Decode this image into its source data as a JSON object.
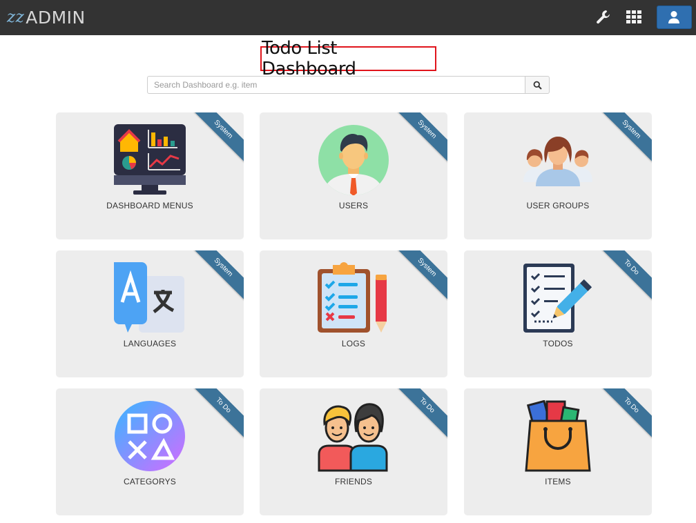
{
  "app": {
    "logo_mark": "zz",
    "logo_text": "ADMIN"
  },
  "header": {
    "title": "Todo List Dashboard"
  },
  "search": {
    "placeholder": "Search Dashboard e.g. item",
    "value": ""
  },
  "cards": [
    {
      "label": "DASHBOARD MENUS",
      "ribbon": "System",
      "icon": "dashboard-monitor-icon"
    },
    {
      "label": "USERS",
      "ribbon": "System",
      "icon": "user-avatar-icon"
    },
    {
      "label": "USER GROUPS",
      "ribbon": "System",
      "icon": "user-group-icon"
    },
    {
      "label": "LANGUAGES",
      "ribbon": "System",
      "icon": "translate-icon"
    },
    {
      "label": "LOGS",
      "ribbon": "System",
      "icon": "clipboard-checklist-icon"
    },
    {
      "label": "TODOS",
      "ribbon": "To Do",
      "icon": "todo-list-pen-icon"
    },
    {
      "label": "CATEGORYS",
      "ribbon": "To Do",
      "icon": "shapes-icon"
    },
    {
      "label": "FRIENDS",
      "ribbon": "To Do",
      "icon": "friends-icon"
    },
    {
      "label": "ITEMS",
      "ribbon": "To Do",
      "icon": "shopping-bag-icon"
    }
  ],
  "colors": {
    "topbar": "#333333",
    "accent": "#2f6fb0",
    "ribbon": "#3c7399",
    "card_bg": "#ededed",
    "title_border": "#e0131b"
  }
}
